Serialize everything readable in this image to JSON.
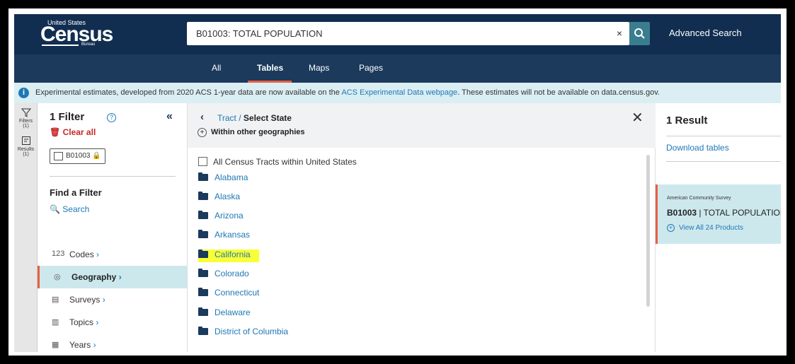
{
  "header": {
    "logo_top": "United States",
    "logo_main": "Census",
    "logo_sub": "Bureau",
    "search_value": "B01003: TOTAL POPULATION",
    "clear_glyph": "×",
    "advanced_search": "Advanced Search"
  },
  "tabs": [
    {
      "label": "All"
    },
    {
      "label": "Tables"
    },
    {
      "label": "Maps"
    },
    {
      "label": "Pages"
    }
  ],
  "active_tab": "Tables",
  "banner": {
    "before": "Experimental estimates, developed from 2020 ACS 1-year data are now available on the ",
    "link": "ACS Experimental Data webpage",
    "after": ". These estimates will not be available on data.census.gov."
  },
  "rail": {
    "filters_label": "Filters",
    "filters_count": "(1)",
    "results_label": "Results",
    "results_count": "(1)"
  },
  "filter_panel": {
    "title": "1 Filter",
    "collapse": "«",
    "clear_all": "Clear all",
    "chip": "B01003",
    "find_title": "Find a Filter",
    "search_label": "Search",
    "items": [
      {
        "icon": "123",
        "label": "Codes"
      },
      {
        "icon": "◎",
        "label": "Geography"
      },
      {
        "icon": "▤",
        "label": "Surveys"
      },
      {
        "icon": "▥",
        "label": "Topics"
      },
      {
        "icon": "▦",
        "label": "Years"
      }
    ]
  },
  "geo_panel": {
    "crumb_level": "Tract",
    "crumb_sep": " / ",
    "crumb_current": "Select State",
    "close": "✕",
    "other_geos": "Within other geographies",
    "all_label": "All Census Tracts within United States",
    "states": [
      "Alabama",
      "Alaska",
      "Arizona",
      "Arkansas",
      "California",
      "Colorado",
      "Connecticut",
      "Delaware",
      "District of Columbia"
    ],
    "highlighted": "California"
  },
  "results_panel": {
    "title": "1 Result",
    "download": "Download tables",
    "source": "American Community Survey",
    "table_code": "B01003",
    "table_sep": " | ",
    "table_name": "TOTAL POPULATION",
    "view_all": "View All 24 Products"
  }
}
